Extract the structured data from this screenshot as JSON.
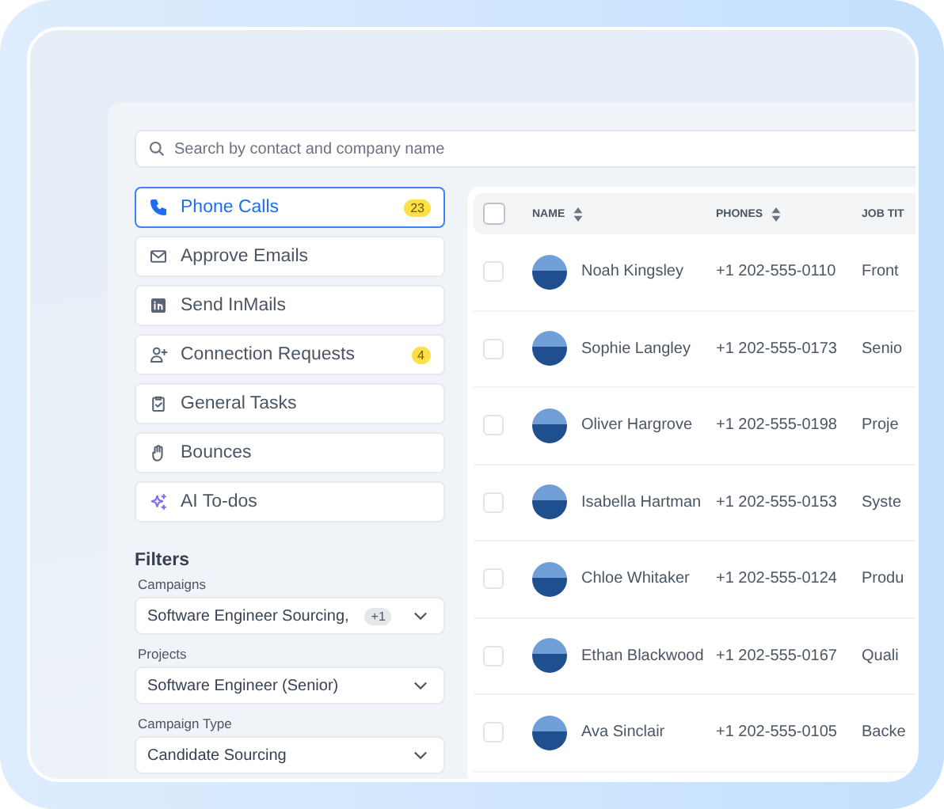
{
  "search": {
    "placeholder": "Search by contact and company name"
  },
  "task_types": [
    {
      "label": "Phone Calls",
      "badge": "23",
      "selected": true
    },
    {
      "label": "Approve Emails",
      "selected": false
    },
    {
      "label": "Send InMails",
      "selected": false
    },
    {
      "label": "Connection Requests",
      "badge": "4",
      "selected": false
    },
    {
      "label": "General Tasks",
      "selected": false
    },
    {
      "label": "Bounces",
      "selected": false
    },
    {
      "label": "AI To-dos",
      "selected": false
    }
  ],
  "filters": {
    "title": "Filters",
    "fields": [
      {
        "label": "Campaigns",
        "value": "Software Engineer Sourcing,",
        "extra": "+1"
      },
      {
        "label": "Projects",
        "value": "Software Engineer (Senior)"
      },
      {
        "label": "Campaign Type",
        "value": "Candidate Sourcing"
      }
    ]
  },
  "table": {
    "select_all_checked": false,
    "columns": [
      {
        "label": "NAME",
        "sortable": true
      },
      {
        "label": "PHONES",
        "sortable": true
      },
      {
        "label": "JOB TIT"
      }
    ],
    "rows": [
      {
        "name": "Noah Kingsley",
        "phone": "+1 202-555-0110",
        "job_title": "Front",
        "checked": false
      },
      {
        "name": "Sophie Langley",
        "phone": "+1 202-555-0173",
        "job_title": "Senio",
        "checked": false
      },
      {
        "name": "Oliver Hargrove",
        "phone": "+1 202-555-0198",
        "job_title": "Proje",
        "checked": false
      },
      {
        "name": "Isabella Hartman",
        "phone": "+1 202-555-0153",
        "job_title": "Syste",
        "checked": false
      },
      {
        "name": "Chloe Whitaker",
        "phone": "+1 202-555-0124",
        "job_title": "Produ",
        "checked": false
      },
      {
        "name": "Ethan Blackwood",
        "phone": "+1 202-555-0167",
        "job_title": "Quali",
        "checked": false
      },
      {
        "name": "Ava Sinclair",
        "phone": "+1 202-555-0105",
        "job_title": "Backe",
        "checked": false
      }
    ]
  }
}
